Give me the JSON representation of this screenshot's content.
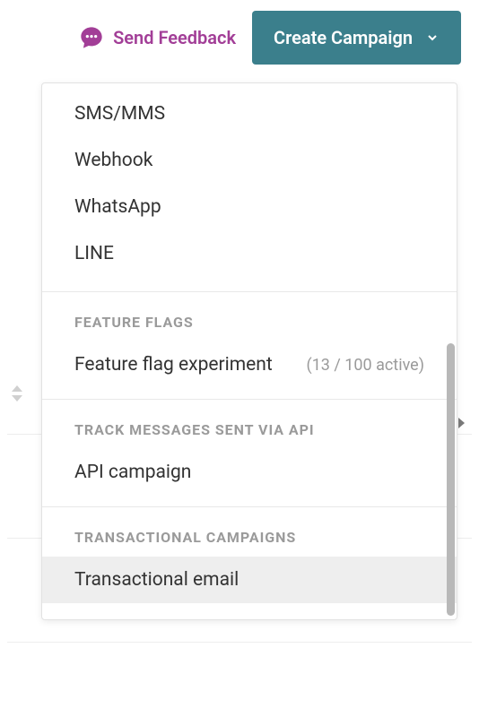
{
  "header": {
    "feedback_label": "Send Feedback",
    "create_button_label": "Create Campaign"
  },
  "dropdown": {
    "top_items": [
      {
        "label": "SMS/MMS"
      },
      {
        "label": "Webhook"
      },
      {
        "label": "WhatsApp"
      },
      {
        "label": "LINE"
      }
    ],
    "sections": [
      {
        "title": "FEATURE FLAGS",
        "items": [
          {
            "label": "Feature flag experiment",
            "meta": "(13 / 100 active)"
          }
        ]
      },
      {
        "title": "TRACK MESSAGES SENT VIA API",
        "items": [
          {
            "label": "API campaign"
          }
        ]
      },
      {
        "title": "TRANSACTIONAL CAMPAIGNS",
        "items": [
          {
            "label": "Transactional email",
            "highlighted": true
          }
        ]
      }
    ]
  }
}
